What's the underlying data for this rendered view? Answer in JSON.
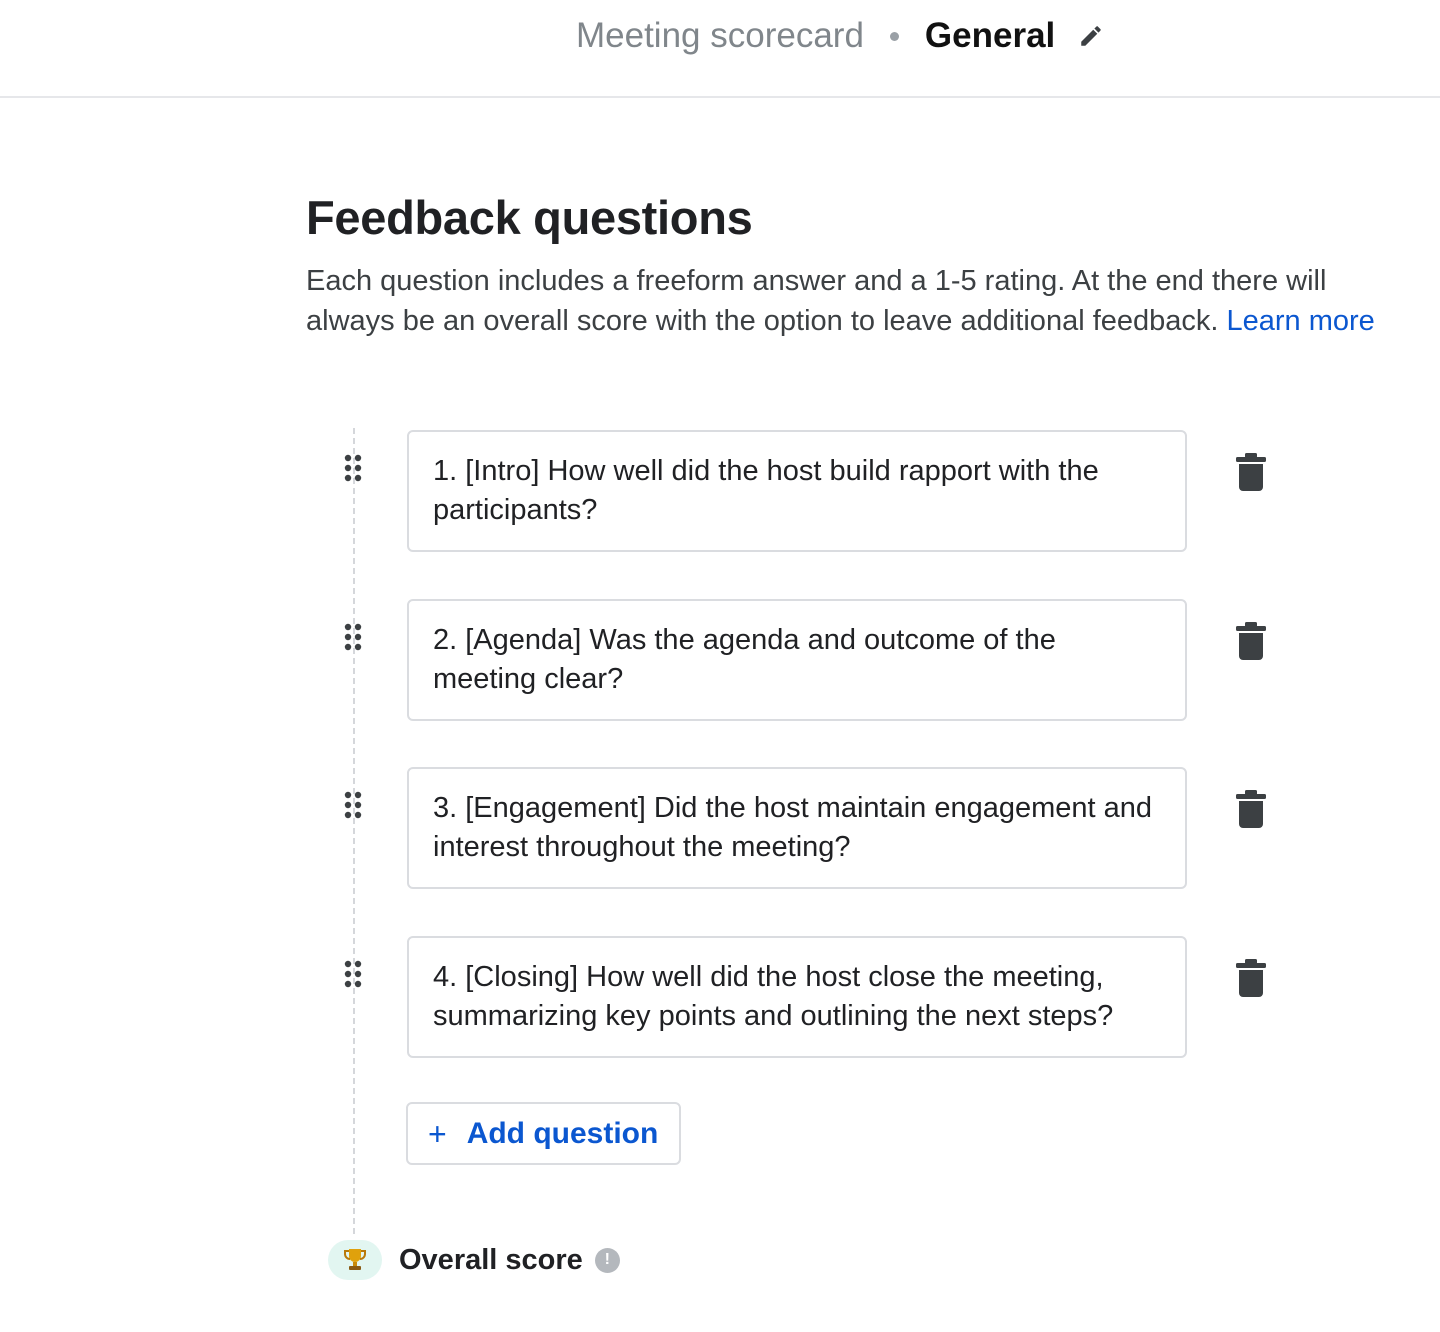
{
  "header": {
    "parent": "Meeting scorecard",
    "current": "General"
  },
  "section": {
    "title": "Feedback questions",
    "description": "Each question includes a freeform answer and a 1-5 rating. At the end there will always be an overall score with the option to leave additional feedback.",
    "learn_more": "Learn more"
  },
  "questions": [
    {
      "text": "1. [Intro] How well did the host build rapport with the participants?"
    },
    {
      "text": "2. [Agenda] Was the agenda and outcome of the meeting clear?"
    },
    {
      "text": "3. [Engagement] Did the host maintain engagement and interest throughout the meeting?"
    },
    {
      "text": "4. [Closing] How well did the host close the meeting, summarizing key points and outlining the next steps?"
    }
  ],
  "add_question": {
    "icon": "+",
    "label": "Add question"
  },
  "overall": {
    "icon": "trophy-icon",
    "label": "Overall score",
    "info_glyph": "!"
  },
  "colors": {
    "link": "#0b57d0",
    "icon_dark": "#3c4043",
    "trophy_badge_bg": "#e2f6f1"
  }
}
